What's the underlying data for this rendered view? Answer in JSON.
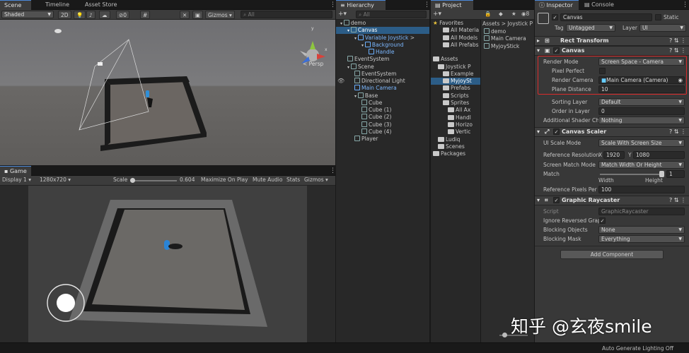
{
  "scene": {
    "tab": "Scene",
    "tab2": "Timeline",
    "tab3": "Asset Store",
    "shading": "Shaded",
    "mode2d": "2D",
    "hidden_count": "0",
    "gizmos": "Gizmos",
    "search_placeholder": "All",
    "persp": "< Persp"
  },
  "game": {
    "tab": "Game",
    "display": "Display 1",
    "resolution": "1280x720",
    "scale_label": "Scale",
    "scale_value": "0.604",
    "maximize": "Maximize On Play",
    "mute": "Mute Audio",
    "stats": "Stats",
    "gizmos": "Gizmos"
  },
  "hierarchy": {
    "tab": "Hierarchy",
    "add": "+▾",
    "search_placeholder": "All",
    "items": [
      {
        "label": "demo",
        "indent": 0,
        "icon": "unity",
        "arrow": "▾",
        "selected": false,
        "blue": false
      },
      {
        "label": "Canvas",
        "indent": 1,
        "icon": "cube",
        "arrow": "▾",
        "selected": true,
        "blue": false
      },
      {
        "label": "Variable Joystick",
        "indent": 2,
        "icon": "cube",
        "arrow": "▾",
        "selected": false,
        "blue": true
      },
      {
        "label": "Background",
        "indent": 3,
        "icon": "cube",
        "arrow": "▾",
        "selected": false,
        "blue": true
      },
      {
        "label": "Handle",
        "indent": 4,
        "icon": "cube",
        "arrow": "",
        "selected": false,
        "blue": true
      },
      {
        "label": "EventSystem",
        "indent": 1,
        "icon": "cube",
        "arrow": "",
        "selected": false,
        "blue": false
      },
      {
        "label": "Scene",
        "indent": 1,
        "icon": "cube",
        "arrow": "▾",
        "selected": false,
        "blue": false
      },
      {
        "label": "EventSystem",
        "indent": 2,
        "icon": "cube",
        "arrow": "",
        "selected": false,
        "blue": false
      },
      {
        "label": "Directional Light",
        "indent": 2,
        "icon": "cube",
        "arrow": "",
        "selected": false,
        "blue": false
      },
      {
        "label": "Main Camera",
        "indent": 2,
        "icon": "cube",
        "arrow": "",
        "selected": false,
        "blue": true
      },
      {
        "label": "Base",
        "indent": 2,
        "icon": "cube",
        "arrow": "▾",
        "selected": false,
        "blue": false
      },
      {
        "label": "Cube",
        "indent": 3,
        "icon": "cube",
        "arrow": "",
        "selected": false,
        "blue": false
      },
      {
        "label": "Cube (1)",
        "indent": 3,
        "icon": "cube",
        "arrow": "",
        "selected": false,
        "blue": false
      },
      {
        "label": "Cube (2)",
        "indent": 3,
        "icon": "cube",
        "arrow": "",
        "selected": false,
        "blue": false
      },
      {
        "label": "Cube (3)",
        "indent": 3,
        "icon": "cube",
        "arrow": "",
        "selected": false,
        "blue": false
      },
      {
        "label": "Cube (4)",
        "indent": 3,
        "icon": "cube",
        "arrow": "",
        "selected": false,
        "blue": false
      },
      {
        "label": "Player",
        "indent": 2,
        "icon": "cube",
        "arrow": "",
        "selected": false,
        "blue": false
      }
    ]
  },
  "project": {
    "tab": "Project",
    "badge": "8",
    "breadcrumb": "Assets > Joystick P",
    "favorites_label": "Favorites",
    "favorites": [
      "All Materia",
      "All Models",
      "All Prefabs"
    ],
    "assets_label": "Assets",
    "tree": [
      {
        "label": "Joystick P",
        "indent": 1
      },
      {
        "label": "Example",
        "indent": 2
      },
      {
        "label": "MyjoySt",
        "indent": 2,
        "selected": true
      },
      {
        "label": "Prefabs",
        "indent": 2
      },
      {
        "label": "Scripts",
        "indent": 2
      },
      {
        "label": "Sprites",
        "indent": 2
      },
      {
        "label": "All Ax",
        "indent": 3
      },
      {
        "label": "Handl",
        "indent": 3
      },
      {
        "label": "Horizo",
        "indent": 3
      },
      {
        "label": "Vertic",
        "indent": 3
      },
      {
        "label": "Ludiq",
        "indent": 1
      },
      {
        "label": "Scenes",
        "indent": 1
      }
    ],
    "packages_label": "Packages",
    "files": [
      "demo",
      "Main Camera",
      "MyjoyStick"
    ]
  },
  "inspector": {
    "tab": "Inspector",
    "tab2": "Console",
    "name": "Canvas",
    "static": "Static",
    "tag_label": "Tag",
    "tag": "Untagged",
    "layer_label": "Layer",
    "layer": "UI",
    "rect_transform": "Rect Transform",
    "canvas": {
      "title": "Canvas",
      "render_mode_label": "Render Mode",
      "render_mode": "Screen Space - Camera",
      "pixel_perfect_label": "Pixel Perfect",
      "render_camera_label": "Render Camera",
      "render_camera": "Main Camera (Camera)",
      "plane_distance_label": "Plane Distance",
      "plane_distance": "10",
      "sorting_layer_label": "Sorting Layer",
      "sorting_layer": "Default",
      "order_label": "Order in Layer",
      "order": "0",
      "shader_label": "Additional Shader Ch",
      "shader": "Nothing"
    },
    "scaler": {
      "title": "Canvas Scaler",
      "scale_mode_label": "UI Scale Mode",
      "scale_mode": "Scale With Screen Size",
      "ref_res_label": "Reference Resolution",
      "x_label": "X",
      "x": "1920",
      "y_label": "Y",
      "y": "1080",
      "match_mode_label": "Screen Match Mode",
      "match_mode": "Match Width Or Height",
      "match_label": "Match",
      "match_value": "1",
      "match_fraction": 1.0,
      "width": "Width",
      "height": "Height",
      "ppu_label": "Reference Pixels Per",
      "ppu": "100"
    },
    "raycaster": {
      "title": "Graphic Raycaster",
      "script_label": "Script",
      "script": "GraphicRaycaster",
      "reverse_label": "Ignore Reversed Grap",
      "blocking_objects_label": "Blocking Objects",
      "blocking_objects": "None",
      "blocking_mask_label": "Blocking Mask",
      "blocking_mask": "Everything"
    },
    "add_component": "Add Component"
  },
  "status": "Auto Generate Lighting Off",
  "watermark": "知乎 @玄夜smile",
  "colors": {
    "highlight": "#d92b2b",
    "selection": "#2c5d87",
    "accent": "#4a88d9"
  }
}
